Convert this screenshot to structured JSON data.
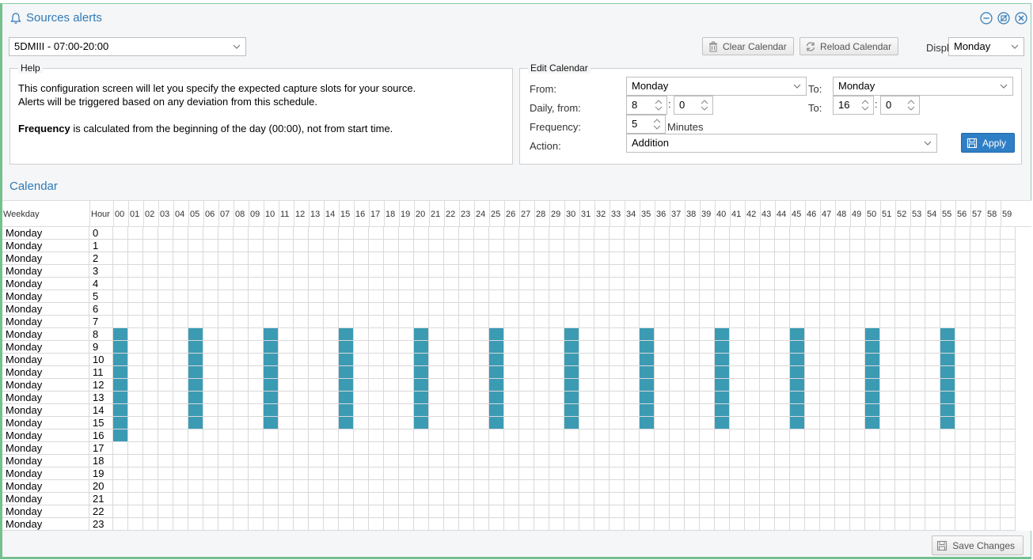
{
  "window": {
    "title": "Sources alerts",
    "icons": [
      "bell-icon",
      "minimize-icon",
      "restore-icon",
      "close-icon"
    ]
  },
  "toolbar": {
    "source_select": "5DMIII - 07:00-20:00",
    "clear_label": "Clear Calendar",
    "reload_label": "Reload Calendar",
    "display_label": "Display:",
    "display_value": "Monday"
  },
  "help": {
    "legend": "Help",
    "line1": "This configuration screen will let you specify the expected capture slots for your source.",
    "line2": "Alerts will be triggered based on any deviation from this schedule.",
    "line3_bold": "Frequency",
    "line3_rest": " is calculated from the beginning of the day (00:00), not from start time."
  },
  "edit": {
    "legend": "Edit Calendar",
    "from_label": "From:",
    "from_value": "Monday",
    "to_label": "To:",
    "to_value": "Monday",
    "daily_from_label": "Daily, from:",
    "daily_from_hour": "8",
    "daily_from_min": "0",
    "daily_to_label": "To:",
    "daily_to_hour": "16",
    "daily_to_min": "0",
    "colon": ":",
    "frequency_label": "Frequency:",
    "frequency_value": "5",
    "frequency_unit": "Minutes",
    "action_label": "Action:",
    "action_value": "Addition",
    "apply_label": "Apply"
  },
  "calendar": {
    "title": "Calendar",
    "weekday_header": "Weekday",
    "hour_header": "Hour",
    "minutes": [
      "00",
      "01",
      "02",
      "03",
      "04",
      "05",
      "06",
      "07",
      "08",
      "09",
      "10",
      "11",
      "12",
      "13",
      "14",
      "15",
      "16",
      "17",
      "18",
      "19",
      "20",
      "21",
      "22",
      "23",
      "24",
      "25",
      "26",
      "27",
      "28",
      "29",
      "30",
      "31",
      "32",
      "33",
      "34",
      "35",
      "36",
      "37",
      "38",
      "39",
      "40",
      "41",
      "42",
      "43",
      "44",
      "45",
      "46",
      "47",
      "48",
      "49",
      "50",
      "51",
      "52",
      "53",
      "54",
      "55",
      "56",
      "57",
      "58",
      "59"
    ],
    "weekday": "Monday",
    "hours": [
      "0",
      "1",
      "2",
      "3",
      "4",
      "5",
      "6",
      "7",
      "8",
      "9",
      "10",
      "11",
      "12",
      "13",
      "14",
      "15",
      "16",
      "17",
      "18",
      "19",
      "20",
      "21",
      "22",
      "23"
    ],
    "active_color": "#3b9bb3",
    "active_slots": {
      "8": [
        0,
        5,
        10,
        15,
        20,
        25,
        30,
        35,
        40,
        45,
        50,
        55
      ],
      "9": [
        0,
        5,
        10,
        15,
        20,
        25,
        30,
        35,
        40,
        45,
        50,
        55
      ],
      "10": [
        0,
        5,
        10,
        15,
        20,
        25,
        30,
        35,
        40,
        45,
        50,
        55
      ],
      "11": [
        0,
        5,
        10,
        15,
        20,
        25,
        30,
        35,
        40,
        45,
        50,
        55
      ],
      "12": [
        0,
        5,
        10,
        15,
        20,
        25,
        30,
        35,
        40,
        45,
        50,
        55
      ],
      "13": [
        0,
        5,
        10,
        15,
        20,
        25,
        30,
        35,
        40,
        45,
        50,
        55
      ],
      "14": [
        0,
        5,
        10,
        15,
        20,
        25,
        30,
        35,
        40,
        45,
        50,
        55
      ],
      "15": [
        0,
        5,
        10,
        15,
        20,
        25,
        30,
        35,
        40,
        45,
        50,
        55
      ],
      "16": [
        0
      ]
    }
  },
  "footer": {
    "save_label": "Save Changes"
  }
}
